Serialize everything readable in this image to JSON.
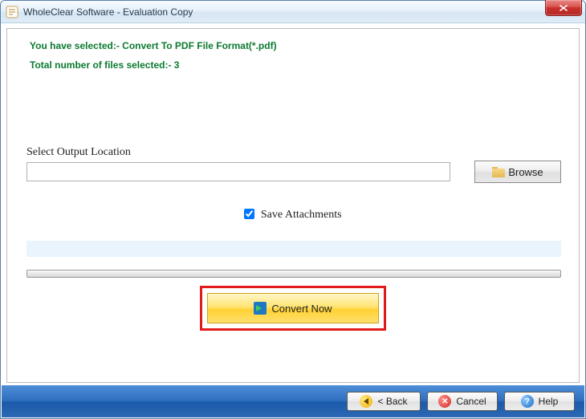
{
  "window": {
    "title": "WholeClear Software - Evaluation Copy"
  },
  "info": {
    "selected_line": "You have selected:- Convert To PDF File Format(*.pdf)",
    "count_line": "Total number of files selected:- 3"
  },
  "output": {
    "label": "Select Output Location",
    "value": "",
    "browse_label": "Browse"
  },
  "options": {
    "save_attachments_label": "Save Attachments",
    "save_attachments_checked": true
  },
  "actions": {
    "convert_label": "Convert Now"
  },
  "footer": {
    "back_label": "< Back",
    "cancel_label": "Cancel",
    "help_label": "Help"
  }
}
